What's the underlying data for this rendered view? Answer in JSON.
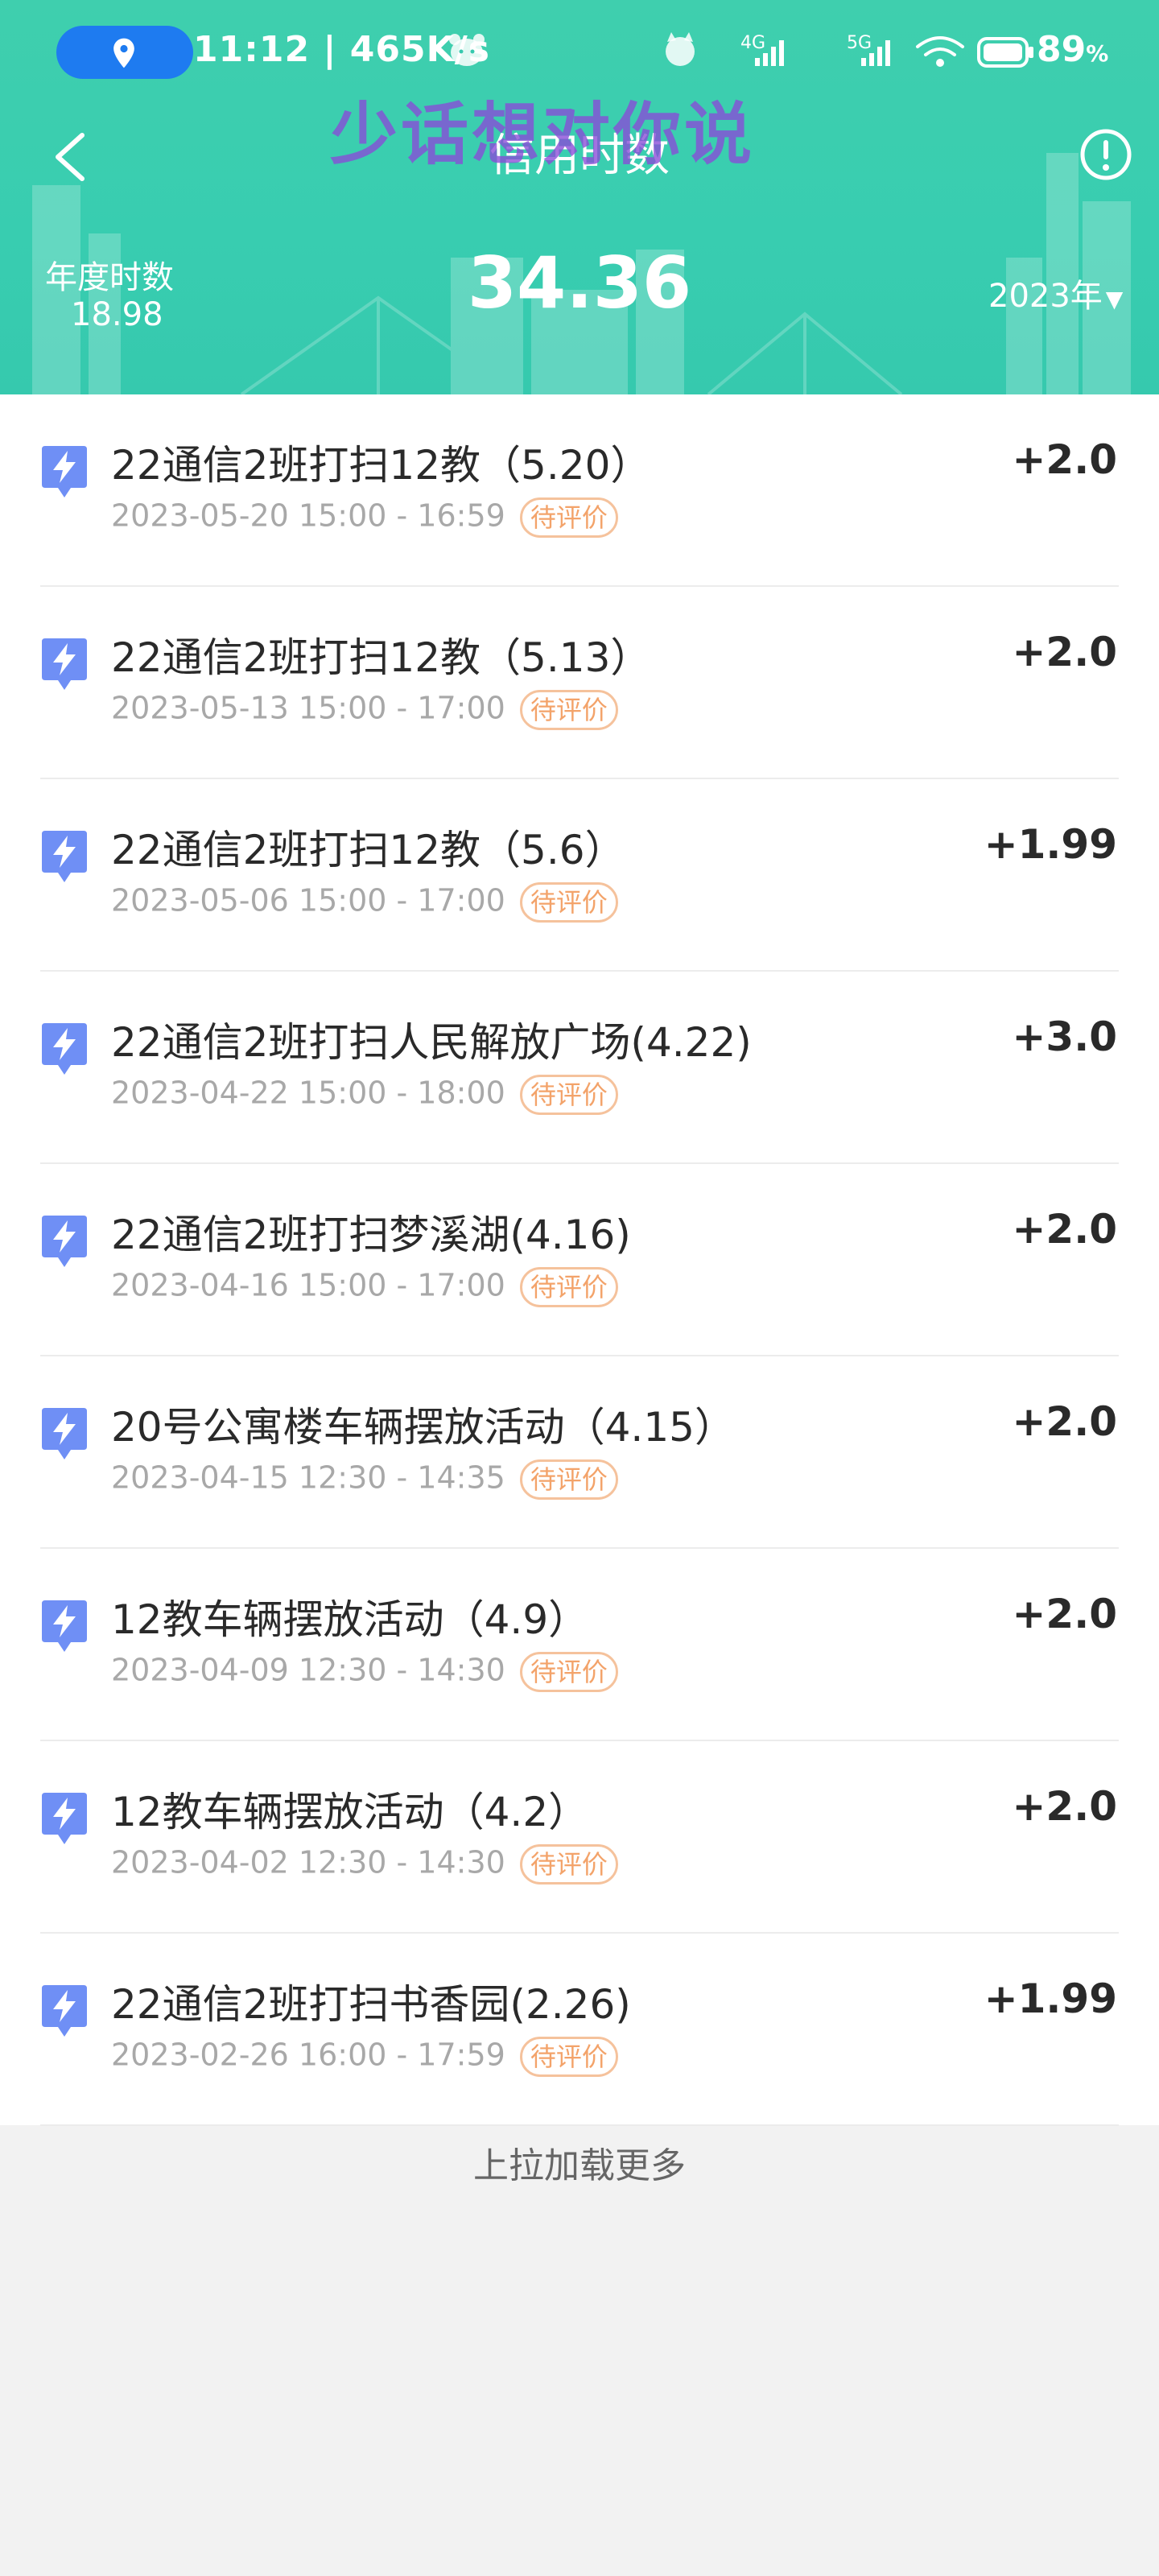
{
  "status_bar": {
    "time_speed": "11:12 | 465K/s",
    "network_1": "4G",
    "network_2": "5G",
    "battery": "89",
    "battery_unit": "%"
  },
  "overlay": {
    "text": "少话想对你说"
  },
  "header": {
    "title": "信用时数",
    "annual_label": "年度时数",
    "annual_value": "18.98",
    "total_hours": "34.36",
    "year": "2023年"
  },
  "colors": {
    "header_green": "#3fcfae",
    "badge_orange": "#f3a36a",
    "icon_blue": "#6f8ff5"
  },
  "activities": [
    {
      "title": "22通信2班打扫12教（5.20）",
      "time": "2023-05-20 15:00 - 16:59",
      "status": "待评价",
      "points": "+2.0"
    },
    {
      "title": "22通信2班打扫12教（5.13）",
      "time": "2023-05-13 15:00 - 17:00",
      "status": "待评价",
      "points": "+2.0"
    },
    {
      "title": "22通信2班打扫12教（5.6）",
      "time": "2023-05-06 15:00 - 17:00",
      "status": "待评价",
      "points": "+1.99"
    },
    {
      "title": "22通信2班打扫人民解放广场(4.22)",
      "time": "2023-04-22 15:00 - 18:00",
      "status": "待评价",
      "points": "+3.0"
    },
    {
      "title": "22通信2班打扫梦溪湖(4.16)",
      "time": "2023-04-16 15:00 - 17:00",
      "status": "待评价",
      "points": "+2.0"
    },
    {
      "title": "20号公寓楼车辆摆放活动（4.15）",
      "time": "2023-04-15 12:30 - 14:35",
      "status": "待评价",
      "points": "+2.0"
    },
    {
      "title": "12教车辆摆放活动（4.9）",
      "time": "2023-04-09 12:30 - 14:30",
      "status": "待评价",
      "points": "+2.0"
    },
    {
      "title": "12教车辆摆放活动（4.2）",
      "time": "2023-04-02 12:30 - 14:30",
      "status": "待评价",
      "points": "+2.0"
    },
    {
      "title": "22通信2班打扫书香园(2.26)",
      "time": "2023-02-26 16:00 - 17:59",
      "status": "待评价",
      "points": "+1.99"
    }
  ],
  "footer": {
    "load_more": "上拉加载更多"
  }
}
